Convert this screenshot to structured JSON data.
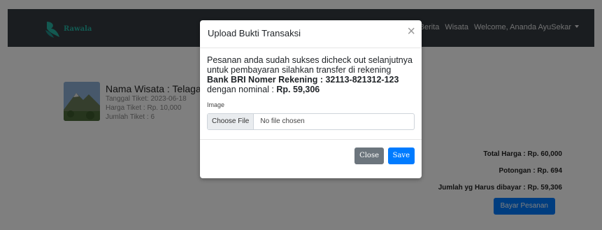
{
  "navbar": {
    "brand": "Rawala",
    "links": [
      "Berita",
      "Wisata",
      "Welcome, Ananda AyuSekar"
    ]
  },
  "card": {
    "title": "Nama Wisata : Telaga M",
    "tanggal": "Tanggal Tiket: 2023-06-18",
    "harga": "Harga Tiket : Rp. 10,000",
    "jumlah": "Jumlah Tiket : 6"
  },
  "summary": {
    "total": "Total Harga : Rp. 60,000",
    "potongan": "Potongan : Rp. 694",
    "harus_dibayar": "Jumlah yg Harus dibayar : Rp. 59,306",
    "pay_button": "Bayar Pesanan"
  },
  "modal": {
    "title": "Upload Bukti Transaksi",
    "close_icon": "×",
    "message_part1": "Pesanan anda sudah sukses dicheck out selanjutnya untuk pembayaran silahkan transfer di rekening ",
    "message_bold1": "Bank BRI Nomer Rekening : 32113-821312-123",
    "message_part2": " dengan nominal : ",
    "message_bold2": "Rp. 59,306",
    "image_label": "Image",
    "choose_file": "Choose File",
    "no_file": "No file chosen",
    "close_button": "Close",
    "save_button": "Save"
  }
}
